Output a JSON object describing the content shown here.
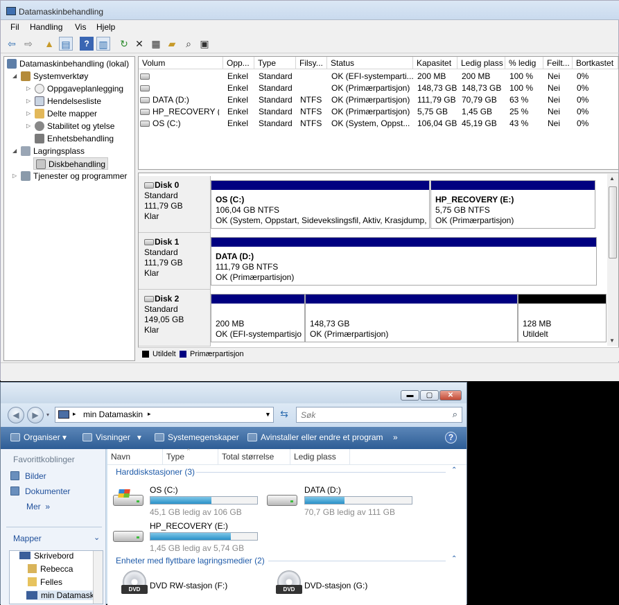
{
  "dm": {
    "title": "Datamaskinbehandling",
    "menu": [
      "Fil",
      "Handling",
      "Vis",
      "Hjelp"
    ],
    "tree": {
      "root": "Datamaskinbehandling (lokal)",
      "systools": "Systemverktøy",
      "task": "Oppgaveplanlegging",
      "events": "Hendelsesliste",
      "shared": "Delte mapper",
      "stability": "Stabilitet og ytelse",
      "devices": "Enhetsbehandling",
      "storage": "Lagringsplass",
      "diskmgmt": "Diskbehandling",
      "services": "Tjenester og programmer"
    },
    "columns": [
      "Volum",
      "Opp...",
      "Type",
      "Filsy...",
      "Status",
      "Kapasitet",
      "Ledig plass",
      "% ledig",
      "Feilt...",
      "Bortkastet"
    ],
    "volumes": [
      {
        "name": "",
        "layout": "Enkel",
        "type": "Standard",
        "fs": "",
        "status": "OK (EFI-systemparti...",
        "cap": "200 MB",
        "free": "200 MB",
        "pct": "100 %",
        "ft": "Nei",
        "ovh": "0%"
      },
      {
        "name": "",
        "layout": "Enkel",
        "type": "Standard",
        "fs": "",
        "status": "OK (Primærpartisjon)",
        "cap": "148,73 GB",
        "free": "148,73 GB",
        "pct": "100 %",
        "ft": "Nei",
        "ovh": "0%"
      },
      {
        "name": "DATA (D:)",
        "layout": "Enkel",
        "type": "Standard",
        "fs": "NTFS",
        "status": "OK (Primærpartisjon)",
        "cap": "111,79 GB",
        "free": "70,79 GB",
        "pct": "63 %",
        "ft": "Nei",
        "ovh": "0%"
      },
      {
        "name": "HP_RECOVERY (E:)",
        "layout": "Enkel",
        "type": "Standard",
        "fs": "NTFS",
        "status": "OK (Primærpartisjon)",
        "cap": "5,75 GB",
        "free": "1,45 GB",
        "pct": "25 %",
        "ft": "Nei",
        "ovh": "0%"
      },
      {
        "name": "OS (C:)",
        "layout": "Enkel",
        "type": "Standard",
        "fs": "NTFS",
        "status": "OK (System, Oppst...",
        "cap": "106,04 GB",
        "free": "45,19 GB",
        "pct": "43 %",
        "ft": "Nei",
        "ovh": "0%"
      }
    ],
    "disks": [
      {
        "name": "Disk 0",
        "type": "Standard",
        "size": "111,79 GB",
        "state": "Klar",
        "parts": [
          {
            "label": "OS  (C:)",
            "size": "106,04 GB NTFS",
            "status": "OK (System, Oppstart, Sidevekslingsfil, Aktiv, Krasjdump,"
          },
          {
            "label": "HP_RECOVERY  (E:)",
            "size": "5,75 GB NTFS",
            "status": "OK (Primærpartisjon)"
          }
        ]
      },
      {
        "name": "Disk 1",
        "type": "Standard",
        "size": "111,79 GB",
        "state": "Klar",
        "parts": [
          {
            "label": "DATA  (D:)",
            "size": "111,79 GB NTFS",
            "status": "OK (Primærpartisjon)"
          }
        ]
      },
      {
        "name": "Disk 2",
        "type": "Standard",
        "size": "149,05 GB",
        "state": "Klar",
        "parts": [
          {
            "label": "",
            "size": "200 MB",
            "status": "OK (EFI-systempartisjo"
          },
          {
            "label": "",
            "size": "148,73 GB",
            "status": "OK (Primærpartisjon)"
          },
          {
            "label": "",
            "size": "128 MB",
            "status": "Utildelt"
          }
        ]
      }
    ],
    "legend": {
      "unallocated": "Utildelt",
      "primary": "Primærpartisjon"
    },
    "colors": {
      "primary": "#000080",
      "unallocated": "#000000"
    }
  },
  "ex": {
    "breadcrumb": "min Datamaskin",
    "search_placeholder": "Søk",
    "commands": [
      "Organiser",
      "Visninger",
      "Systemegenskaper",
      "Avinstaller eller endre et program"
    ],
    "more": "»",
    "nav": {
      "fav_title": "Favorittkoblinger",
      "links": [
        "Bilder",
        "Dokumenter"
      ],
      "more": "Mer",
      "folders_title": "Mapper",
      "tree": [
        "Skrivebord",
        "Rebecca",
        "Felles",
        "min Datamask"
      ]
    },
    "columns": [
      "Navn",
      "Type",
      "Total størrelse",
      "Ledig plass"
    ],
    "group_hdd": "Harddiskstasjoner (3)",
    "group_removable": "Enheter med flyttbare lagringsmedier (2)",
    "drives": [
      {
        "name": "OS (C:)",
        "free": "45,1 GB ledig av 106 GB",
        "used_fraction": 0.57
      },
      {
        "name": "DATA (D:)",
        "free": "70,7 GB ledig av 111 GB",
        "used_fraction": 0.37
      },
      {
        "name": "HP_RECOVERY (E:)",
        "free": "1,45 GB ledig av 5,74 GB",
        "used_fraction": 0.75
      }
    ],
    "optical": [
      {
        "name": "DVD RW-stasjon (F:)",
        "badge": "DVD"
      },
      {
        "name": "DVD-stasjon (G:)",
        "badge": "DVD"
      }
    ]
  }
}
